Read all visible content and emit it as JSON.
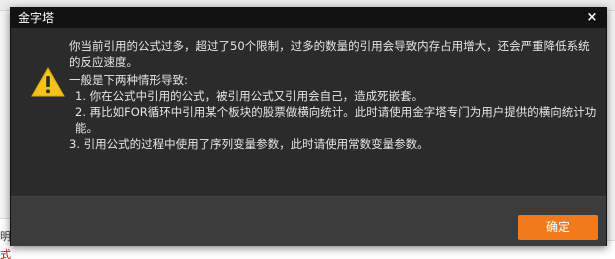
{
  "dialog": {
    "title": "金字塔",
    "close_glyph": "×",
    "icon": "warning-icon",
    "message": {
      "intro": "你当前引用的公式过多，超过了50个限制，过多的数量的引用会导致内存占用增大，还会严重降低系统的反应速度。",
      "lead": "一般是下两种情形导致:",
      "item1": "1. 你在公式中引用的公式，被引用公式又引用会自己，造成死嵌套。",
      "item2": "2. 再比如FOR循环中引用某个板块的股票做横向统计。此时请使用金字塔专门为用户提供的横向统计功能。",
      "item3": "3. 引用公式的过程中使用了序列变量参数，此时请使用常数变量参数。"
    },
    "ok_label": "确定"
  },
  "background": {
    "left_label_1": "明",
    "left_label_2": "式"
  },
  "colors": {
    "title_bar": "#121212",
    "body": "#2b2b2b",
    "footer": "#3c3c3c",
    "accent": "#f07a1c",
    "warning_yellow": "#f3c21c"
  }
}
